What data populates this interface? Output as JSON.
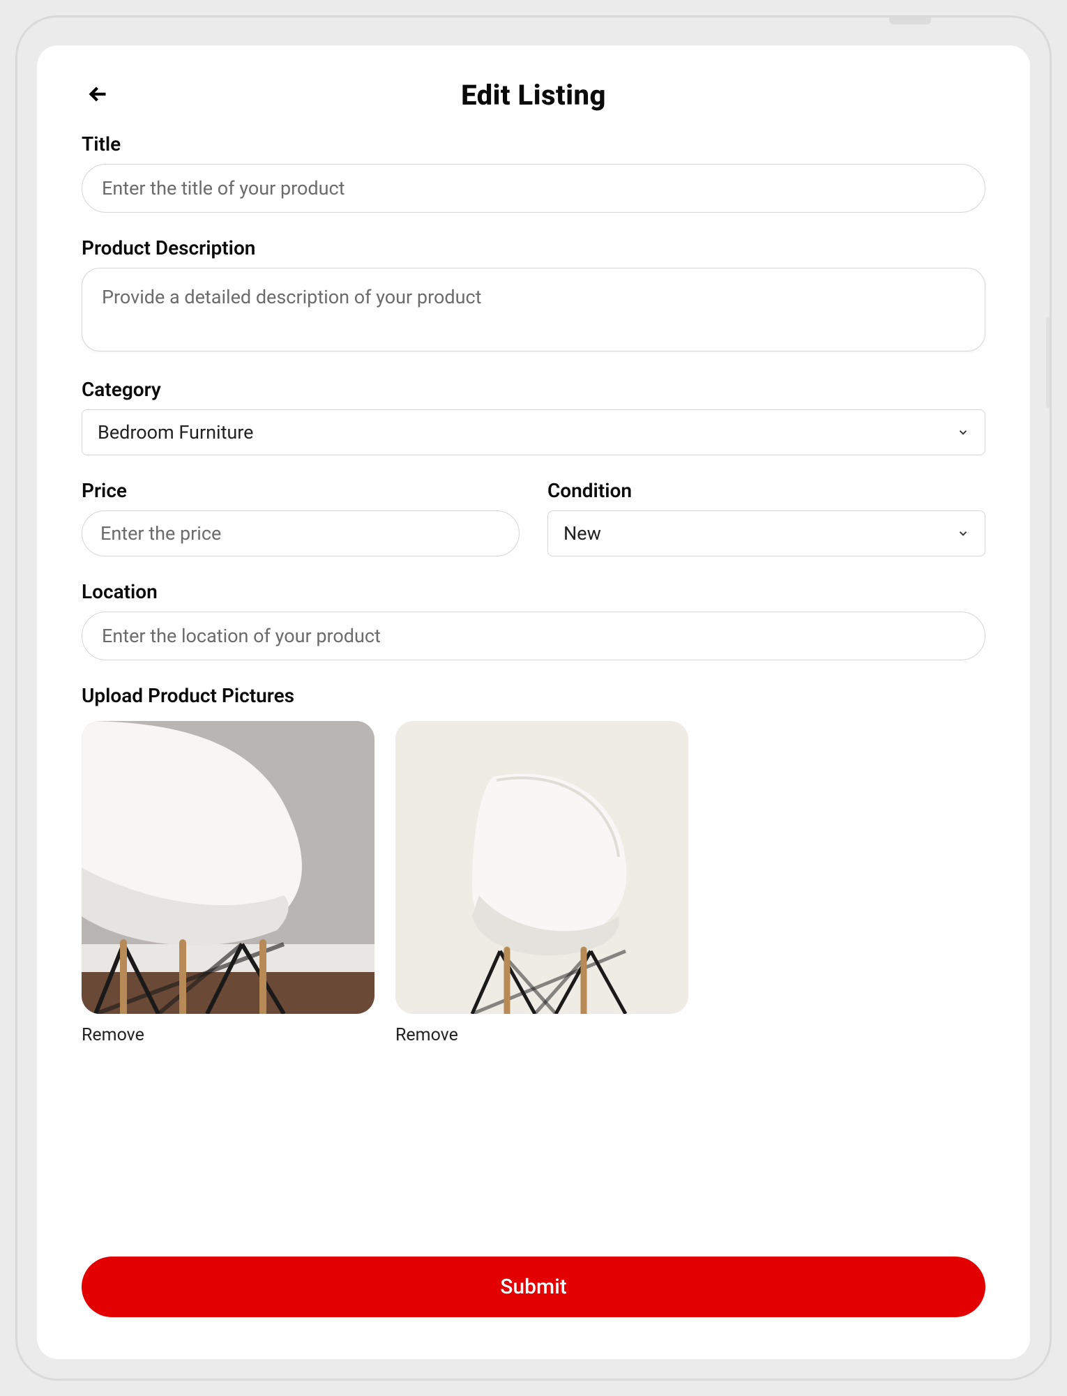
{
  "header": {
    "title": "Edit Listing"
  },
  "form": {
    "title_label": "Title",
    "title_placeholder": "Enter the title of your product",
    "title_value": "",
    "description_label": "Product Description",
    "description_placeholder": "Provide a detailed description of your product",
    "description_value": "",
    "category_label": "Category",
    "category_value": "Bedroom Furniture",
    "price_label": "Price",
    "price_placeholder": "Enter the price",
    "price_value": "",
    "condition_label": "Condition",
    "condition_value": "New",
    "location_label": "Location",
    "location_placeholder": "Enter the location of your product",
    "location_value": "",
    "upload_label": "Upload Product Pictures",
    "images": [
      {
        "remove_label": "Remove"
      },
      {
        "remove_label": "Remove"
      }
    ],
    "submit_label": "Submit"
  },
  "icons": {
    "back": "arrow-left-icon",
    "chevron": "chevron-down-icon"
  },
  "colors": {
    "accent": "#e20000",
    "border": "#d6d6d6",
    "text": "#0a0a0a",
    "placeholder": "#6b6b6b"
  }
}
